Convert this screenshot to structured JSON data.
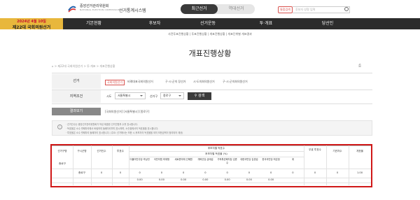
{
  "header": {
    "org": "중앙선거관리위원회",
    "org_sub": "NATIONAL ELECTION COMMISSION",
    "system": "선거통계시스템",
    "tab_current": "최근선거",
    "tab_past": "역대선거",
    "search_btn": "통합검색",
    "search_placeholder": "후보자 성명 입력"
  },
  "badge": {
    "date": "2024년 4월 10일",
    "title": "제22대 국회의원선거"
  },
  "menu": [
    "기본현황",
    "후보자",
    "선거운동",
    "투·개표",
    "당선인"
  ],
  "subnav": "사전투표진행상황 | 투표진행상황 | 개표진행상황 | 개표단위별 개표결과",
  "page_title": "개표진행상황",
  "breadcrumb": "⌂ > 제22대 국회의원선거 > 투·개표 > 개표진행상황",
  "print": "⎙",
  "form": {
    "election_label": "선거",
    "election_types": [
      "국회의원선거",
      "비례대표국회의원선거",
      "구·시·군의 장선거",
      "시·도의회의원선거",
      "구·시·군의회의원선거"
    ],
    "region_label": "지역조건",
    "sido_label": "시도",
    "sido_value": "서울특별시",
    "gu_label": "선거구",
    "gu_value": "종로구",
    "search_label": "검색"
  },
  "result": {
    "label": "결과보기",
    "text": "[국회의원선거] [서울특별시] [종로구]"
  },
  "notes": [
    "· 선거인수는 중앙선거관리위원회가 작성 제출한 선거인명부 수를 표시합니다.",
    "· 득표율은 소수 셋째자리에서 버림하여 둘째자리까지 표시하며, 소숫점에서의 득표율을 표시합니다.",
    "· 투표율은 소수 셋째자리 둘째자리 표시합니다. (주요: 선거에서는 보한 시 후보자의 득표율을 외의 보한금액이 정리되어 제공)"
  ],
  "table": {
    "headers": [
      "선거구명",
      "구시군명",
      "선거인수",
      "투표수",
      "후보자별 득표수",
      "후보자별 득표율 (%)",
      "무효 투표수",
      "기권자수",
      "개표율"
    ],
    "candidates": [
      "더불어민주당 곽상언",
      "국민의힘 최재형",
      "새로운미래 선혜원",
      "개혁신당 금태섭",
      "가락특권폐지당 김준수",
      "대한국민당 김경섭",
      "한국국민당 최은정",
      "계"
    ],
    "rows": [
      {
        "district": "종로구",
        "sigungu": "",
        "electors": "",
        "voters": "",
        "votes": [
          "",
          "",
          "",
          "",
          "",
          "",
          "",
          ""
        ],
        "invalid": "",
        "abstain": "",
        "rate": ""
      },
      {
        "district": "",
        "sigungu": "종로구",
        "electors": "0",
        "voters": "0",
        "votes": [
          "0",
          "0",
          "0",
          "0",
          "0",
          "0",
          "0",
          "0"
        ],
        "invalid": "0",
        "abstain": "0",
        "rate": "1.00"
      },
      {
        "district": "",
        "sigungu": "",
        "electors": "",
        "voters": "",
        "votes": [
          "0.00",
          "0.00",
          "0.00",
          "0.00",
          "0.00",
          "0.00",
          "0.00",
          ""
        ],
        "invalid": "",
        "abstain": "",
        "rate": ""
      }
    ]
  },
  "colors": {
    "nav_bg": "#2c2c2c",
    "badge_bg": "#e8b73c",
    "highlight": "#d01818"
  }
}
